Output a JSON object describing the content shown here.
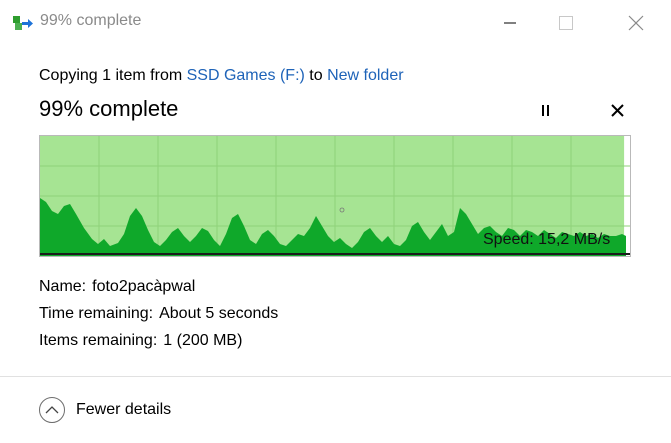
{
  "window": {
    "title": "99% complete",
    "icon": "copy-arrow-icon"
  },
  "copy": {
    "prefix": "Copying 1 item from ",
    "source": "SSD Games (F:)",
    "connector": " to ",
    "destination": "New folder"
  },
  "progress": {
    "label": "99% complete",
    "fraction": 0.99
  },
  "graph": {
    "speed_label": "Speed: 15,2 MB/s",
    "colors": {
      "fill": "#a6e493",
      "area": "#0fa82a",
      "grid": "#8fd27a",
      "baseline": "#1c1c1c"
    }
  },
  "details": {
    "name_label": "Name:",
    "name_value": "foto2pacàpwal",
    "time_label": "Time remaining:",
    "time_value": "About 5 seconds",
    "items_label": "Items remaining:",
    "items_value": "1 (200 MB)"
  },
  "footer": {
    "fewer_details": "Fewer details"
  }
}
